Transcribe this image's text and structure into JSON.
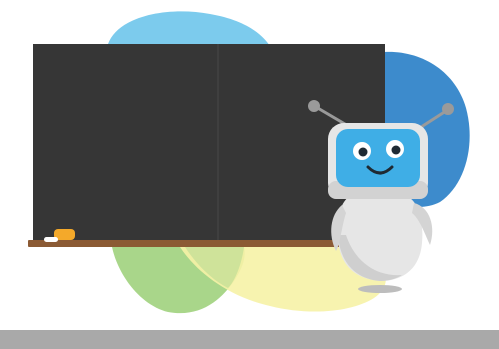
{
  "scene": {
    "title": "",
    "colors": {
      "background": "#ffffff",
      "chalkboard": "#363636",
      "chalk_ledge": "#8b5a34",
      "blob_light_blue": "#7ccbed",
      "blob_dark_blue": "#3d8bcc",
      "blob_green": "#a9d68a",
      "blob_yellow": "#f6f2a6",
      "robot_face": "#3faee6",
      "robot_body": "#e6e6e6",
      "chalk_orange": "#f4a92a",
      "footer_bar": "#a9a9a9"
    },
    "icons": {
      "robot": "robot-mascot-icon",
      "chalk": "chalk-icon"
    }
  }
}
